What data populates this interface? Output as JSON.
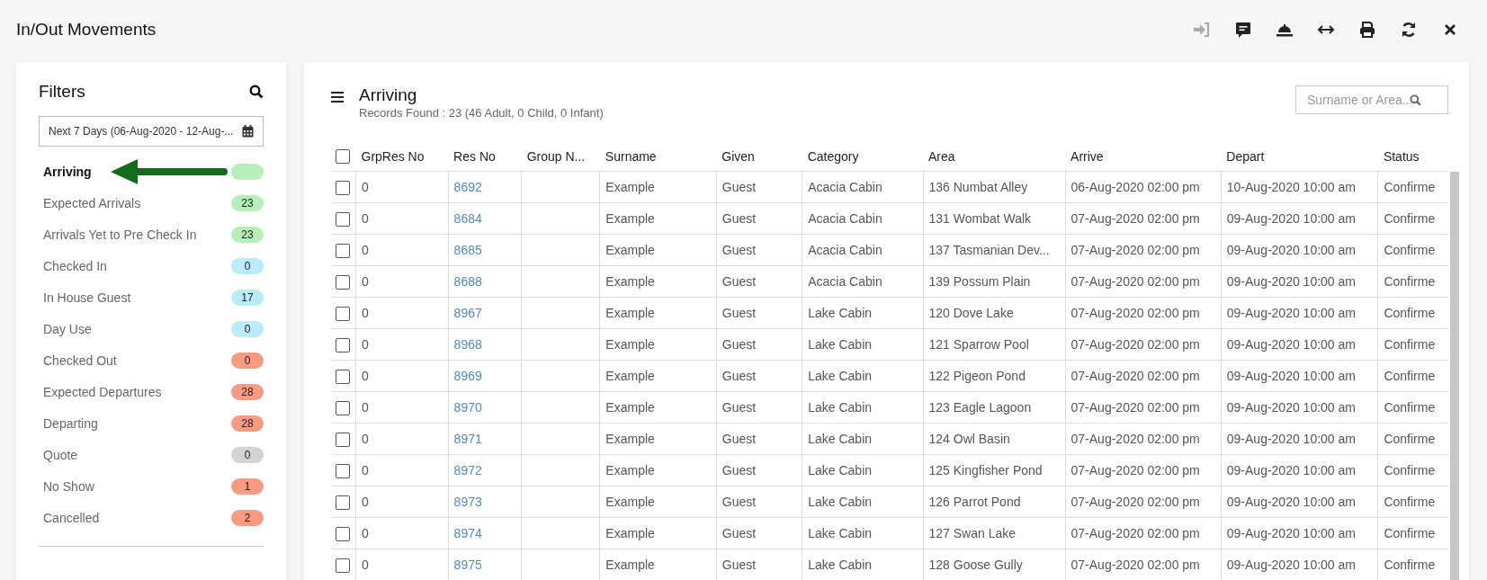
{
  "window": {
    "title": "In/Out Movements"
  },
  "toolbar": [
    {
      "kind": "login",
      "disabled": true
    },
    {
      "kind": "message",
      "disabled": false
    },
    {
      "kind": "bell",
      "disabled": false
    },
    {
      "kind": "resize",
      "disabled": false
    },
    {
      "kind": "print",
      "disabled": false
    },
    {
      "kind": "refresh",
      "disabled": false
    },
    {
      "kind": "close",
      "disabled": false
    }
  ],
  "filters": {
    "title": "Filters",
    "date_range": "Next 7 Days (06-Aug-2020 - 12-Aug-...",
    "items": [
      {
        "label": "Arriving",
        "selected": true,
        "color": "#b6f0b8"
      },
      {
        "label": "Expected Arrivals",
        "count": "23",
        "selected": false,
        "color": "#b6f0b8"
      },
      {
        "label": "Arrivals Yet to Pre Check In",
        "count": "23",
        "selected": false,
        "color": "#b6f0b8"
      },
      {
        "label": "Checked In",
        "count": "0",
        "selected": false,
        "color": "#b8ecfb"
      },
      {
        "label": "In House Guest",
        "count": "17",
        "selected": false,
        "color": "#b8ecfb"
      },
      {
        "label": "Day Use",
        "count": "0",
        "selected": false,
        "color": "#b8ecfb"
      },
      {
        "label": "Checked Out",
        "count": "0",
        "selected": false,
        "color": "#f99a82"
      },
      {
        "label": "Expected Departures",
        "count": "28",
        "selected": false,
        "color": "#f99a82"
      },
      {
        "label": "Departing",
        "count": "28",
        "selected": false,
        "color": "#f99a82"
      },
      {
        "label": "Quote",
        "count": "0",
        "selected": false,
        "color": "#d3d3d3"
      },
      {
        "label": "No Show",
        "count": "1",
        "selected": false,
        "color": "#f99a82"
      },
      {
        "label": "Cancelled",
        "count": "2",
        "selected": false,
        "color": "#f99a82"
      }
    ]
  },
  "list": {
    "title": "Arriving",
    "records": "Records Found : 23 (46 Adult, 0 Child, 0 Infant)",
    "search": {
      "placeholder": "Surname or Area..."
    },
    "table": {
      "columns": [
        "GrpRes No",
        "Res No",
        "Group N...",
        "Surname",
        "Given",
        "Category",
        "Area",
        "Arrive",
        "Depart",
        "Status"
      ],
      "header_checked": false,
      "rows": [
        {
          "checked": false,
          "cells": [
            "0",
            "8692",
            "",
            "Example",
            "Guest",
            "Acacia Cabin",
            "136 Numbat Alley",
            "06-Aug-2020 02:00 pm",
            "10-Aug-2020 10:00 am",
            "Confirme"
          ]
        },
        {
          "checked": false,
          "cells": [
            "0",
            "8684",
            "",
            "Example",
            "Guest",
            "Acacia Cabin",
            "131 Wombat Walk",
            "07-Aug-2020 02:00 pm",
            "09-Aug-2020 10:00 am",
            "Confirme"
          ]
        },
        {
          "checked": false,
          "cells": [
            "0",
            "8685",
            "",
            "Example",
            "Guest",
            "Acacia Cabin",
            "137 Tasmanian Dev...",
            "07-Aug-2020 02:00 pm",
            "09-Aug-2020 10:00 am",
            "Confirme"
          ]
        },
        {
          "checked": false,
          "cells": [
            "0",
            "8688",
            "",
            "Example",
            "Guest",
            "Acacia Cabin",
            "139 Possum Plain",
            "07-Aug-2020 02:00 pm",
            "09-Aug-2020 10:00 am",
            "Confirme"
          ]
        },
        {
          "checked": false,
          "cells": [
            "0",
            "8967",
            "",
            "Example",
            "Guest",
            "Lake Cabin",
            "120 Dove Lake",
            "07-Aug-2020 02:00 pm",
            "09-Aug-2020 10:00 am",
            "Confirme"
          ]
        },
        {
          "checked": false,
          "cells": [
            "0",
            "8968",
            "",
            "Example",
            "Guest",
            "Lake Cabin",
            "121 Sparrow Pool",
            "07-Aug-2020 02:00 pm",
            "09-Aug-2020 10:00 am",
            "Confirme"
          ]
        },
        {
          "checked": false,
          "cells": [
            "0",
            "8969",
            "",
            "Example",
            "Guest",
            "Lake Cabin",
            "122 Pigeon Pond",
            "07-Aug-2020 02:00 pm",
            "09-Aug-2020 10:00 am",
            "Confirme"
          ]
        },
        {
          "checked": false,
          "cells": [
            "0",
            "8970",
            "",
            "Example",
            "Guest",
            "Lake Cabin",
            "123 Eagle Lagoon",
            "07-Aug-2020 02:00 pm",
            "09-Aug-2020 10:00 am",
            "Confirme"
          ]
        },
        {
          "checked": false,
          "cells": [
            "0",
            "8971",
            "",
            "Example",
            "Guest",
            "Lake Cabin",
            "124 Owl Basin",
            "07-Aug-2020 02:00 pm",
            "09-Aug-2020 10:00 am",
            "Confirme"
          ]
        },
        {
          "checked": false,
          "cells": [
            "0",
            "8972",
            "",
            "Example",
            "Guest",
            "Lake Cabin",
            "125 Kingfisher Pond",
            "07-Aug-2020 02:00 pm",
            "09-Aug-2020 10:00 am",
            "Confirme"
          ]
        },
        {
          "checked": false,
          "cells": [
            "0",
            "8973",
            "",
            "Example",
            "Guest",
            "Lake Cabin",
            "126 Parrot Pond",
            "07-Aug-2020 02:00 pm",
            "09-Aug-2020 10:00 am",
            "Confirme"
          ]
        },
        {
          "checked": false,
          "cells": [
            "0",
            "8974",
            "",
            "Example",
            "Guest",
            "Lake Cabin",
            "127 Swan Lake",
            "07-Aug-2020 02:00 pm",
            "09-Aug-2020 10:00 am",
            "Confirme"
          ]
        },
        {
          "checked": false,
          "cells": [
            "0",
            "8975",
            "",
            "Example",
            "Guest",
            "Lake Cabin",
            "128 Goose Gully",
            "07-Aug-2020 02:00 pm",
            "09-Aug-2020 10:00 am",
            "Confirme"
          ]
        }
      ]
    }
  }
}
